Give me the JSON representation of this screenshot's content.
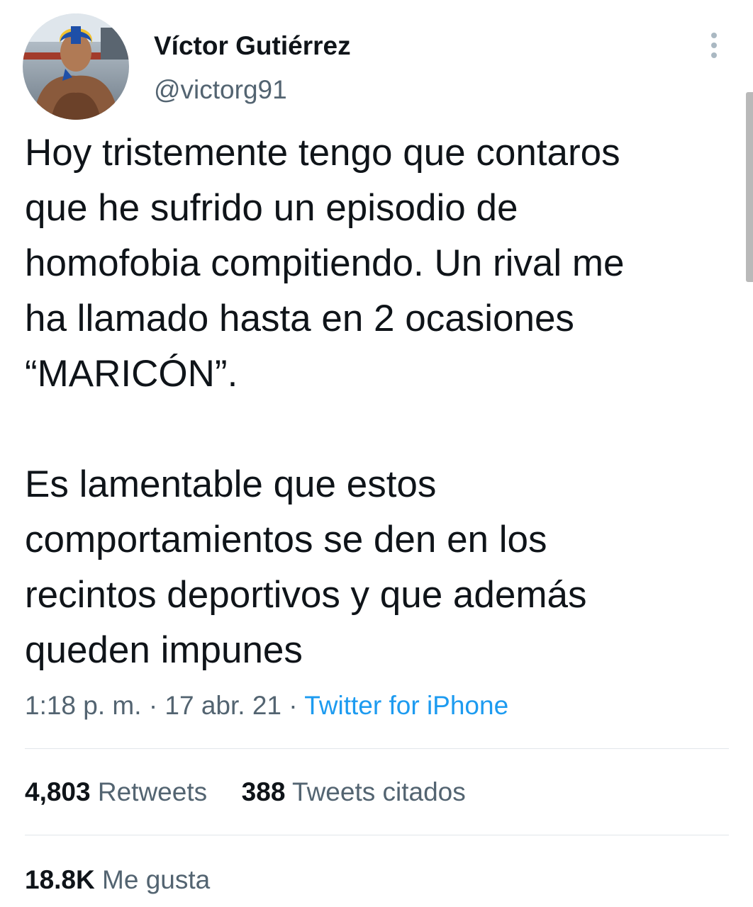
{
  "user": {
    "display_name": "Víctor Gutiérrez",
    "handle": "@victorg91",
    "avatar_icon": "profile-photo"
  },
  "tweet": {
    "paragraphs": [
      [
        "Hoy tristemente tengo que contaros",
        "que he sufrido un episodio de",
        "homofobia compitiendo. Un rival me",
        "ha llamado hasta en 2 ocasiones",
        "“MARICÓN”."
      ],
      [
        "Es lamentable que estos",
        "comportamientos se den en los",
        "recintos deportivos y que además",
        "queden impunes"
      ]
    ],
    "time": "1:18 p. m.",
    "separator": "·",
    "date": "17 abr. 21",
    "source": "Twitter for iPhone"
  },
  "stats": {
    "retweets_count": "4,803",
    "retweets_label": "Retweets",
    "quotes_count": "388",
    "quotes_label": "Tweets citados",
    "likes_count": "18.8K",
    "likes_label": "Me gusta"
  },
  "colors": {
    "text": "#0f1419",
    "secondary": "#536471",
    "link": "#1d9bf0",
    "divider": "#e1e6ea"
  }
}
